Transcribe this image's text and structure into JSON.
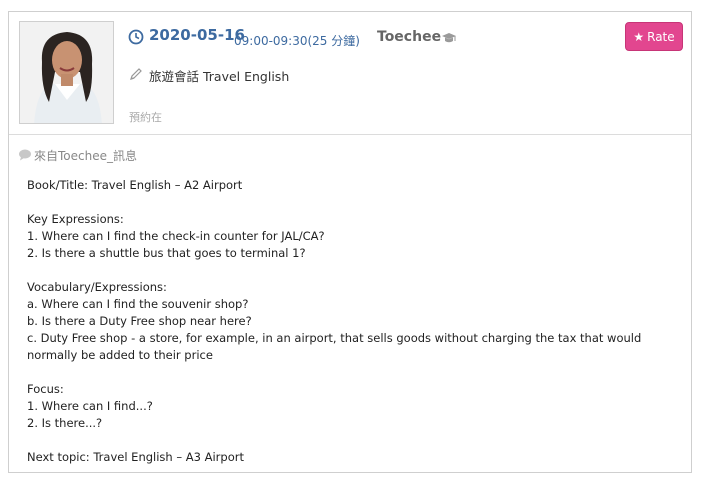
{
  "lesson": {
    "date": "2020-05-16",
    "time": "09:00-09:30(25 分鐘)",
    "teacher": "Toechee",
    "course": "旅遊會話 Travel English",
    "booked_label": "預約在"
  },
  "actions": {
    "rate_label": "Rate"
  },
  "message": {
    "from_label": "來自Toechee_訊息",
    "book_title": "Book/Title: Travel English – A2 Airport",
    "key_heading": "Key Expressions:",
    "key_items": [
      "1. Where can I find the check-in counter for JAL/CA?",
      "2. Is there a shuttle bus that goes to terminal 1?"
    ],
    "vocab_heading": "Vocabulary/Expressions:",
    "vocab_items": [
      "a. Where can I find the souvenir shop?",
      "b. Is there a Duty Free shop near here?",
      "c. Duty Free shop - a store, for example, in an airport, that sells goods without charging the tax that would normally be added to their price"
    ],
    "focus_heading": "Focus:",
    "focus_items": [
      "1. Where can I find...?",
      "2. Is there...?"
    ],
    "next_topic": "Next topic: Travel English – A3 Airport"
  },
  "icons": [
    "clock-icon",
    "graduation-cap-icon",
    "star-icon",
    "pencil-icon",
    "speech-bubble-icon"
  ],
  "colors": {
    "accent_blue": "#3d6aa0",
    "rate_pink": "#e2468f"
  }
}
